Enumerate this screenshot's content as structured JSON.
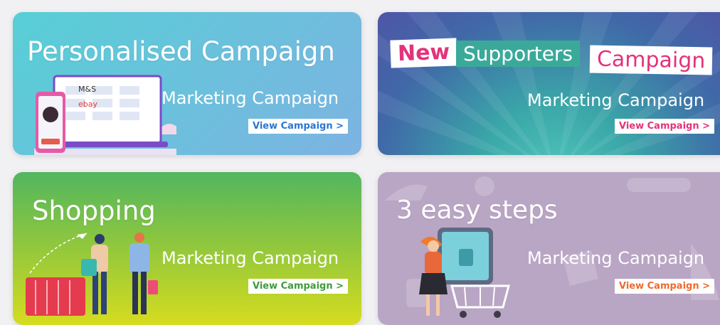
{
  "cards": [
    {
      "title": "Personalised Campaign",
      "subtitle": "Marketing Campaign",
      "button": "View Campaign >",
      "button_color": "#2a76d2",
      "brands": [
        "M&S",
        "ebay"
      ],
      "illustration": "laptop-phone-icon"
    },
    {
      "banner": [
        "New",
        "Supporters",
        "Campaign"
      ],
      "subtitle": "Marketing Campaign",
      "button": "View Campaign >",
      "button_color": "#e3337a",
      "illustration": "sunburst-icon"
    },
    {
      "title": "Shopping",
      "subtitle": "Marketing Campaign",
      "button": "View Campaign >",
      "button_color": "#3e9b3a",
      "illustration": "shoppers-basket-icon"
    },
    {
      "title": "3 easy steps",
      "subtitle": "Marketing Campaign",
      "button": "View Campaign >",
      "button_color": "#ef6a2d",
      "illustration": "woman-trolley-icon"
    }
  ]
}
